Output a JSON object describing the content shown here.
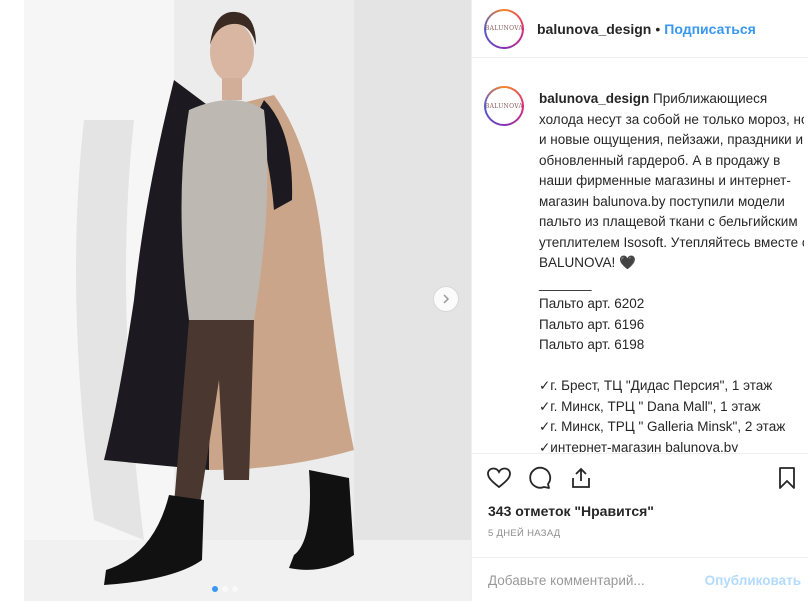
{
  "post": {
    "username": "balunova_design",
    "separator": "•",
    "follow_label": "Подписаться",
    "avatar_text": "BALUNOVA",
    "caption_user": "balunova_design",
    "caption_text": " Приближающиеся холода несут за собой не только мороз, но и новые ощущения, пейзажи, праздники и обновленный гардероб. А в продажу в наши фирменные магазины и интернет-магазин balunova.by поступили модели пальто из плащевой ткани с бельгийским утеплителем Isosoft. Утепляйтесь вместе с BALUNOVA! 🖤\n_______\nПальто арт. 6202\nПальто арт. 6196\nПальто арт. 6198\n\n✓г. Брест, ТЦ \"Дидас Персия\", 1 этаж\n✓г. Минск, ТРЦ \" Dana Mall\", 1 этаж\n✓г. Минск, ТРЦ \" Galleria Minsk\", 2 этаж\n✓интернет-магазин balunova.by",
    "likes": "343 отметок \"Нравится\"",
    "date": "5 ДНЕЙ НАЗАД",
    "comment_placeholder": "Добавьте комментарий...",
    "publish_label": "Опубликовать"
  },
  "carousel": {
    "active_index": 0,
    "count": 3
  },
  "icons": [
    "heart-icon",
    "comment-icon",
    "share-icon",
    "bookmark-icon",
    "chevron-right-icon"
  ],
  "colors": {
    "accent": "#3897f0",
    "text": "#262626",
    "muted": "#8e8e8e"
  }
}
